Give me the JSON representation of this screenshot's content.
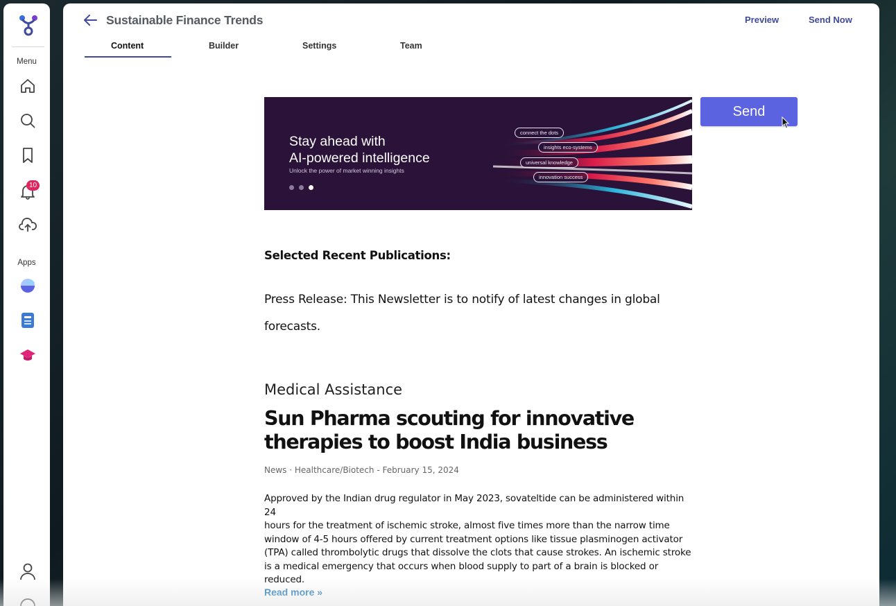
{
  "sidebar": {
    "menu_label": "Menu",
    "apps_label": "Apps",
    "notification_count": "10",
    "icons": [
      "logo-icon",
      "home-icon",
      "search-icon",
      "bookmark-icon",
      "bell-icon",
      "cloud-upload-icon",
      "chart-app-icon",
      "document-app-icon",
      "graduation-cap-icon",
      "user-icon",
      "help-icon"
    ]
  },
  "header": {
    "title": "Sustainable Finance Trends",
    "preview_label": "Preview",
    "send_now_label": "Send Now"
  },
  "tabs": [
    {
      "label": "Content",
      "active": true
    },
    {
      "label": "Builder",
      "active": false
    },
    {
      "label": "Settings",
      "active": false
    },
    {
      "label": "Team",
      "active": false
    }
  ],
  "banner": {
    "title_line1": "Stay ahead with",
    "title_line2": "AI-powered intelligence",
    "subtitle": "Unlock the power of market winning insights",
    "pills": [
      "connect the dots",
      "insights eco-systems",
      "universal knowledge",
      "innovation success"
    ],
    "active_slide": 3,
    "slide_count": 3
  },
  "send_button_label": "Send",
  "publications": {
    "heading": "Selected Recent Publications:",
    "press_line1": "Press Release: This Newsletter is to notify of latest changes in global",
    "press_line2": "forecasts."
  },
  "article": {
    "category": "Medical Assistance",
    "headline_line1": "Sun Pharma scouting for innovative",
    "headline_line2": "therapies to boost India business",
    "meta": "News · Healthcare/Biotech - February 15, 2024",
    "body_lines": [
      "Approved by the Indian drug regulator in May 2023, sovateltide can be administered within 24",
      "hours for the treatment of ischemic stroke, almost five times more than the narrow time",
      "window of 4-5 hours offered by current treatment options like tissue plasminogen activator",
      "(TPA) called thrombolytic drugs that dissolve the clots that cause strokes. An ischemic stroke",
      "is a medical emergency that occurs when blood supply to part of a brain is blocked or",
      "reduced."
    ],
    "read_more": "Read more »"
  },
  "colors": {
    "accent": "#3f4a9c",
    "send_button": "#5b63e0",
    "banner_bg": "#2a1238",
    "badge": "#e0245e",
    "link": "#2c7fbf"
  }
}
